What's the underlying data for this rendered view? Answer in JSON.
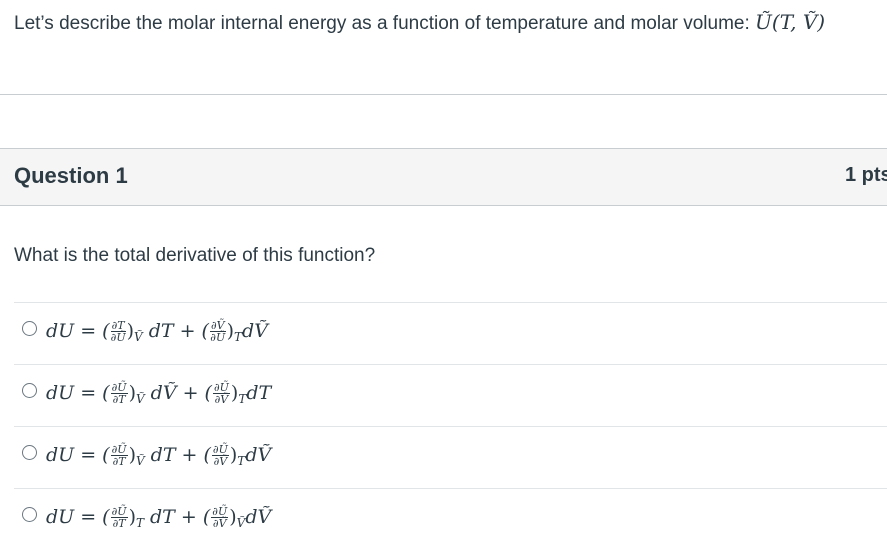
{
  "intro": {
    "text": "Let’s describe the molar internal energy as a function of temperature and molar volume: ",
    "math": "Ũ(T, Ṽ)"
  },
  "question": {
    "title": "Question 1",
    "points": "1 pts",
    "prompt": "What is the total derivative of this function?"
  },
  "answers": [
    {
      "lhs": "dU = (",
      "n1": "∂T",
      "d1": "∂Ũ",
      "s1": "Ṽ",
      "m1": "dT + (",
      "n2": "∂Ṽ",
      "d2": "∂Ũ",
      "s2": "T",
      "m2": "dṼ"
    },
    {
      "lhs": "dU = (",
      "n1": "∂Ũ",
      "d1": "∂T",
      "s1": "Ṽ",
      "m1": "dṼ + (",
      "n2": "∂Ũ",
      "d2": "∂Ṽ",
      "s2": "T",
      "m2": "dT"
    },
    {
      "lhs": "dU = (",
      "n1": "∂Ũ",
      "d1": "∂T",
      "s1": "Ṽ",
      "m1": "dT + (",
      "n2": "∂Ũ",
      "d2": "∂Ṽ",
      "s2": "T",
      "m2": "dṼ"
    },
    {
      "lhs": "dU = (",
      "n1": "∂Ũ",
      "d1": "∂T",
      "s1": "T",
      "m1": "dT + (",
      "n2": "∂Ũ",
      "d2": "∂Ṽ",
      "s2": "Ṽ",
      "m2": "dṼ"
    }
  ]
}
